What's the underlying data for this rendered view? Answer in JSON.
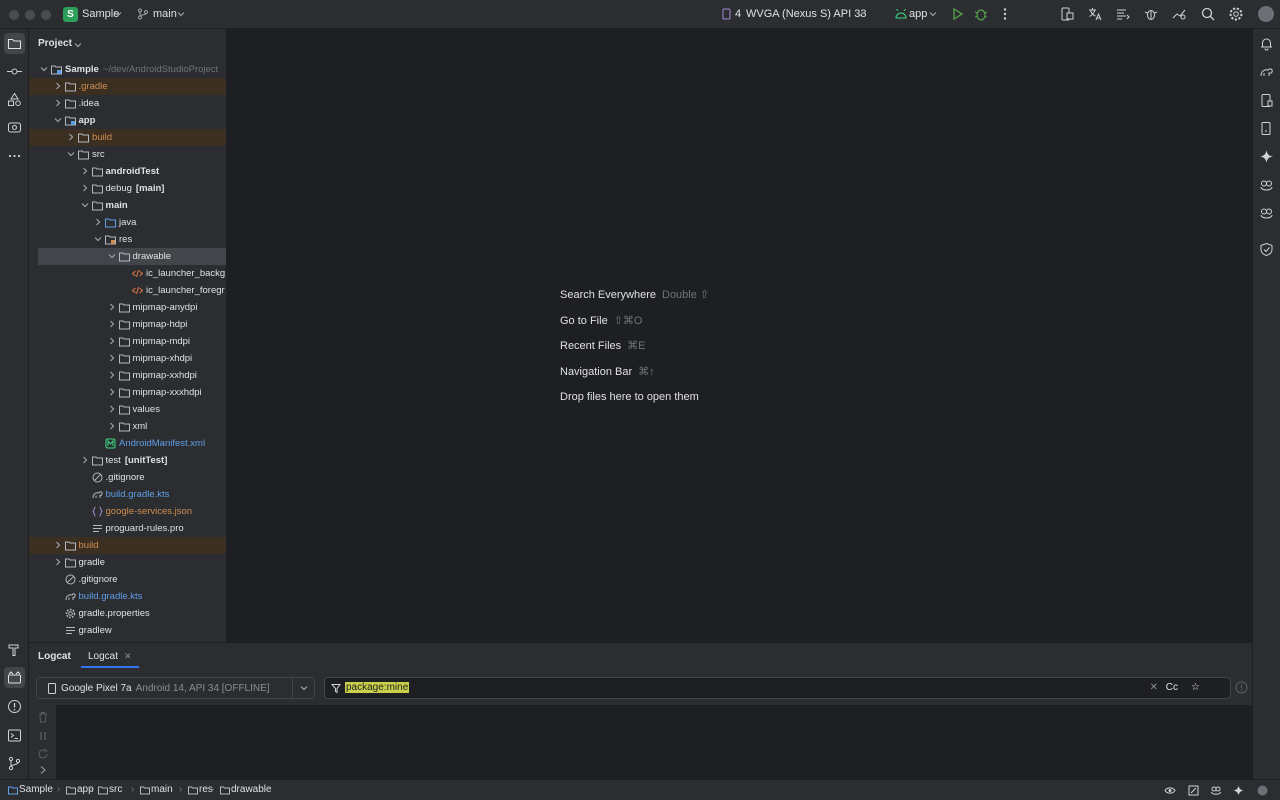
{
  "titlebar": {
    "project_initial": "S",
    "project_name": "Sample",
    "branch": "main",
    "device_count": "4",
    "device_name": "WVGA (Nexus S) API 33",
    "run_config": "app"
  },
  "project_panel": {
    "title": "Project",
    "root": {
      "label": "Sample",
      "path": "~/dev/AndroidStudioProject"
    },
    "rows": [
      {
        "label": ".gradle"
      },
      {
        "label": ".idea"
      },
      {
        "label": "app"
      },
      {
        "label": "build"
      },
      {
        "label": "src"
      },
      {
        "label": "androidTest"
      },
      {
        "label": "debug",
        "suffix": "[main]"
      },
      {
        "label": "main"
      },
      {
        "label": "java"
      },
      {
        "label": "res"
      },
      {
        "label": "drawable"
      },
      {
        "label": "ic_launcher_backg"
      },
      {
        "label": "ic_launcher_foregr"
      },
      {
        "label": "mipmap-anydpi"
      },
      {
        "label": "mipmap-hdpi"
      },
      {
        "label": "mipmap-mdpi"
      },
      {
        "label": "mipmap-xhdpi"
      },
      {
        "label": "mipmap-xxhdpi"
      },
      {
        "label": "mipmap-xxxhdpi"
      },
      {
        "label": "values"
      },
      {
        "label": "xml"
      },
      {
        "label": "AndroidManifest.xml"
      },
      {
        "label": "test",
        "suffix": "[unitTest]"
      },
      {
        "label": ".gitignore"
      },
      {
        "label": "build.gradle.kts"
      },
      {
        "label": "google-services.json"
      },
      {
        "label": "proguard-rules.pro"
      },
      {
        "label": "build"
      },
      {
        "label": "gradle"
      },
      {
        "label": ".gitignore"
      },
      {
        "label": "build.gradle.kts"
      },
      {
        "label": "gradle.properties"
      },
      {
        "label": "gradlew"
      }
    ]
  },
  "editor_hints": [
    {
      "label": "Search Everywhere",
      "shortcut": "Double ⇧"
    },
    {
      "label": "Go to File",
      "shortcut": "⇧⌘O"
    },
    {
      "label": "Recent Files",
      "shortcut": "⌘E"
    },
    {
      "label": "Navigation Bar",
      "shortcut": "⌘↑"
    },
    {
      "label": "Drop files here to open them",
      "shortcut": ""
    }
  ],
  "logcat": {
    "panel_title": "Logcat",
    "tab_label": "Logcat",
    "device_name": "Google Pixel 7a",
    "device_details": "Android 14, API 34 [OFFLINE]",
    "filter_value": "package:mine",
    "case_label": "Cc"
  },
  "statusbar": {
    "breadcrumb": [
      "Sample",
      "app",
      "src",
      "main",
      "res",
      "drawable"
    ]
  },
  "colors": {
    "accent": "#3574f0",
    "excluded_folder": "#d08c4f",
    "source_folder": "#5f9fe8",
    "badge": "#2e9e5b"
  }
}
